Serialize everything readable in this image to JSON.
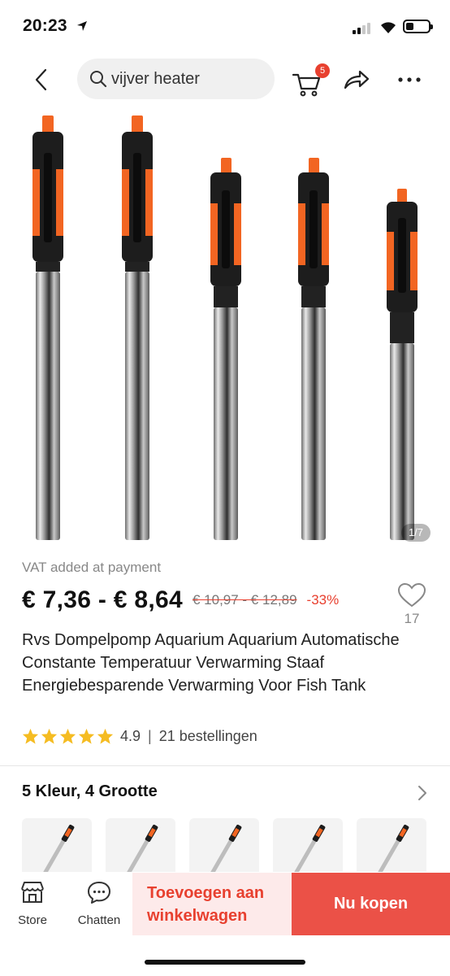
{
  "status_bar": {
    "time": "20:23"
  },
  "nav": {
    "search_text": "vijver heater",
    "cart_count": "5"
  },
  "gallery": {
    "counter": "1/7"
  },
  "product": {
    "vat_note": "VAT added at payment",
    "price_range": "€ 7,36 - € 8,64",
    "original_price": "€ 10,97 - € 12,89",
    "discount": "-33%",
    "favorites": "17",
    "title": "Rvs Dompelpomp Aquarium Aquarium Automatische Constante Temperatuur Verwarming Staaf Energiebesparende Verwarming Voor Fish Tank",
    "rating": "4.9",
    "orders": "21 bestellingen"
  },
  "variants": {
    "title": "5 Kleur, 4 Grootte"
  },
  "bottom_bar": {
    "store_label": "Store",
    "chat_label": "Chatten",
    "add_to_cart_line1": "Toevoegen aan",
    "add_to_cart_line2": "winkelwagen",
    "buy_now": "Nu kopen"
  },
  "colors": {
    "accent": "#e8402f",
    "buy_button": "#eb5147",
    "heater_orange": "#f26522"
  }
}
